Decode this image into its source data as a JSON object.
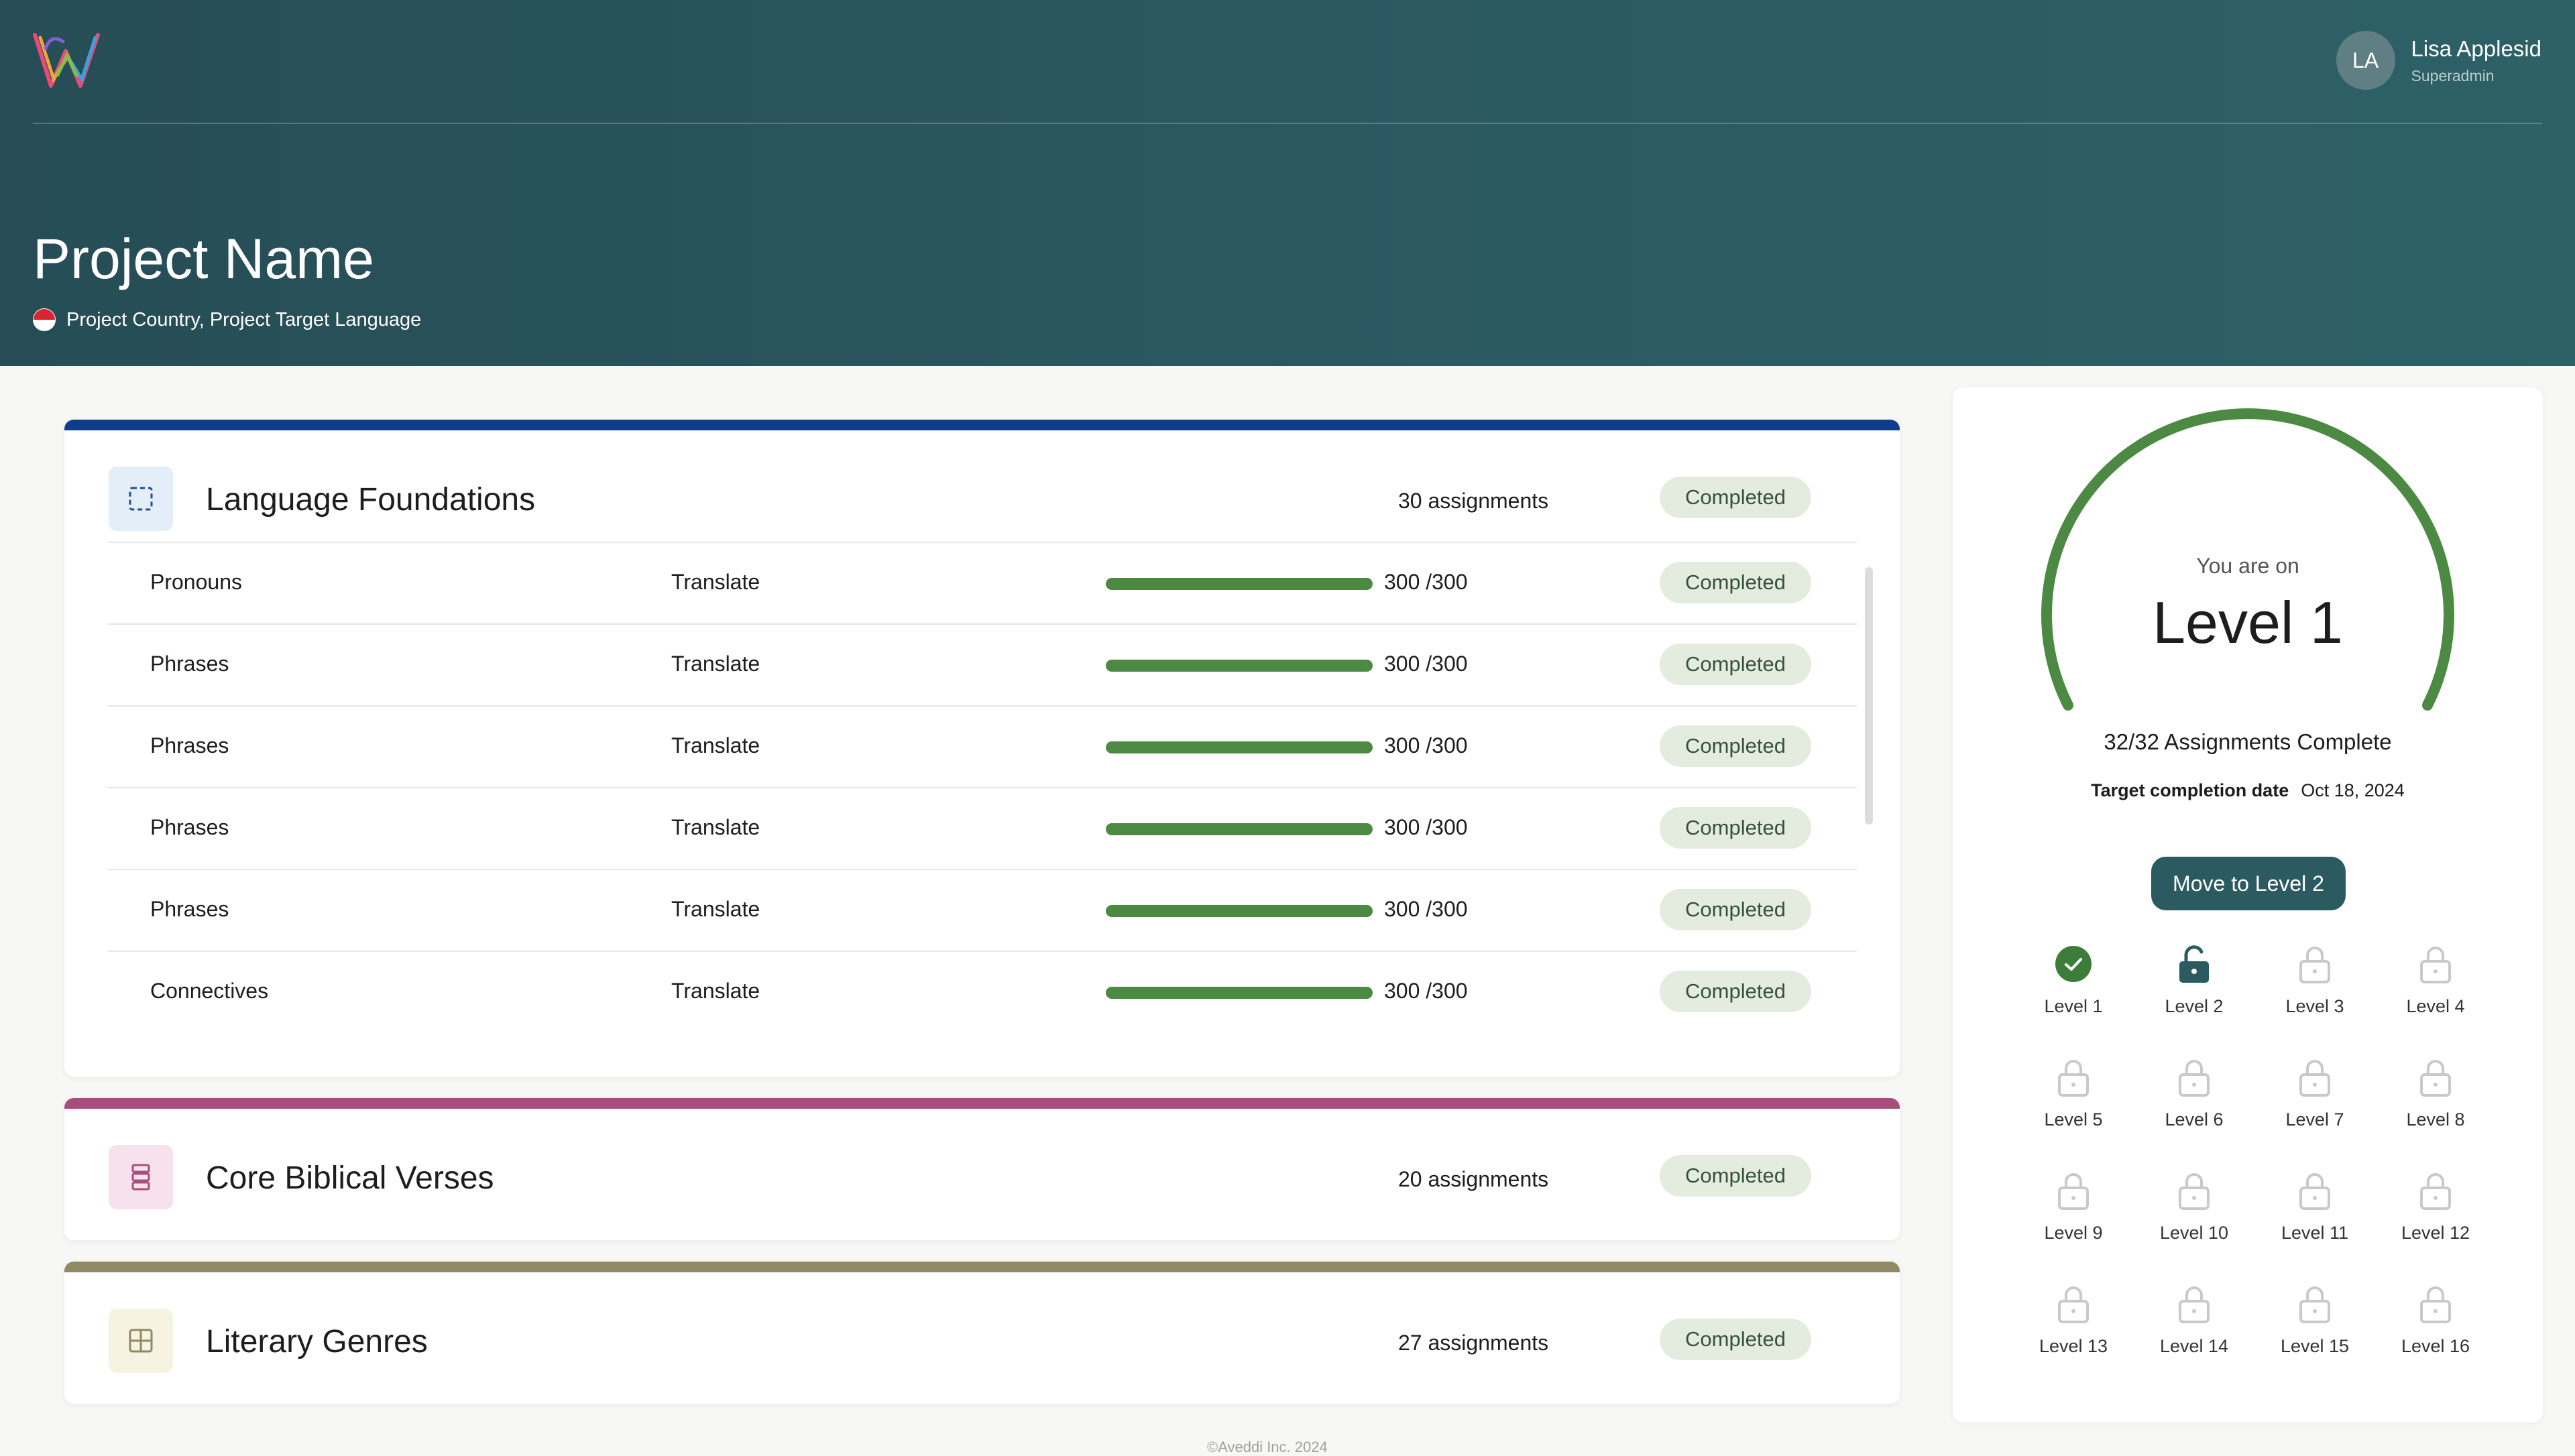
{
  "user": {
    "initials": "LA",
    "name": "Lisa Applesid",
    "role": "Superadmin"
  },
  "project": {
    "title": "Project Name",
    "subtitle": "Project Country, Project Target Language"
  },
  "cards": [
    {
      "title": "Language Foundations",
      "assignments": "30 assignments",
      "status": "Completed",
      "color": "#0f3d8c",
      "icon": "dashed-square-icon"
    },
    {
      "title": "Core Biblical Verses",
      "assignments": "20 assignments",
      "status": "Completed",
      "color": "#a64f7c",
      "icon": "stack-icon"
    },
    {
      "title": "Literary Genres",
      "assignments": "27 assignments",
      "status": "Completed",
      "color": "#918963",
      "icon": "grid-icon"
    }
  ],
  "rows": [
    {
      "name": "Pronouns",
      "type": "Translate",
      "progress": 1.0,
      "count": "300 /300",
      "status": "Completed"
    },
    {
      "name": "Phrases",
      "type": "Translate",
      "progress": 1.0,
      "count": "300 /300",
      "status": "Completed"
    },
    {
      "name": "Phrases",
      "type": "Translate",
      "progress": 1.0,
      "count": "300 /300",
      "status": "Completed"
    },
    {
      "name": "Phrases",
      "type": "Translate",
      "progress": 1.0,
      "count": "300 /300",
      "status": "Completed"
    },
    {
      "name": "Phrases",
      "type": "Translate",
      "progress": 1.0,
      "count": "300 /300",
      "status": "Completed"
    },
    {
      "name": "Connectives",
      "type": "Translate",
      "progress": 1.0,
      "count": "300 /300",
      "status": "Completed"
    }
  ],
  "side": {
    "you_are_on": "You are on",
    "level": "Level 1",
    "complete": "32/32 Assignments Complete",
    "target_label": "Target completion date",
    "target_date": "Oct 18, 2024",
    "button": "Move to Level 2",
    "gauge_progress": 1.0,
    "gauge_color": "#4c8a43"
  },
  "levels": [
    {
      "label": "Level 1",
      "state": "done"
    },
    {
      "label": "Level 2",
      "state": "unlocked"
    },
    {
      "label": "Level 3",
      "state": "locked"
    },
    {
      "label": "Level 4",
      "state": "locked"
    },
    {
      "label": "Level 5",
      "state": "locked"
    },
    {
      "label": "Level 6",
      "state": "locked"
    },
    {
      "label": "Level 7",
      "state": "locked"
    },
    {
      "label": "Level 8",
      "state": "locked"
    },
    {
      "label": "Level 9",
      "state": "locked"
    },
    {
      "label": "Level 10",
      "state": "locked"
    },
    {
      "label": "Level 11",
      "state": "locked"
    },
    {
      "label": "Level 12",
      "state": "locked"
    },
    {
      "label": "Level 13",
      "state": "locked"
    },
    {
      "label": "Level 14",
      "state": "locked"
    },
    {
      "label": "Level 15",
      "state": "locked"
    },
    {
      "label": "Level 16",
      "state": "locked"
    }
  ],
  "footer": "©Aveddi Inc. 2024"
}
